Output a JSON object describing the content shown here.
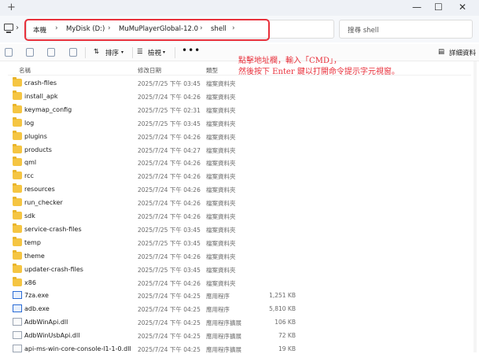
{
  "window": {
    "new_tab": "+",
    "minimize": "—",
    "maximize": "☐",
    "close": "✕"
  },
  "breadcrumb": [
    "本機",
    "MyDisk (D:)",
    "MuMuPlayerGlobal-12.0",
    "shell"
  ],
  "search": {
    "placeholder": "搜尋 shell"
  },
  "toolbar": {
    "sort": "排序",
    "view": "檢視",
    "more": "•••",
    "details": "詳細資料"
  },
  "columns": {
    "name": "名稱",
    "date": "修改日期",
    "type": "類型"
  },
  "annotation": {
    "line1": "點擊地址欄，輸入「CMD」，",
    "line2": "然後按下 Enter 鍵以打開命令提示字元視窗。"
  },
  "files": [
    {
      "name": "crash-files",
      "date": "2025/7/25 下午 03:45",
      "type": "檔案資料夾",
      "size": "",
      "kind": "folder"
    },
    {
      "name": "install_apk",
      "date": "2025/7/24 下午 04:26",
      "type": "檔案資料夾",
      "size": "",
      "kind": "folder"
    },
    {
      "name": "keymap_config",
      "date": "2025/7/25 下午 02:31",
      "type": "檔案資料夾",
      "size": "",
      "kind": "folder"
    },
    {
      "name": "log",
      "date": "2025/7/25 下午 03:45",
      "type": "檔案資料夾",
      "size": "",
      "kind": "folder"
    },
    {
      "name": "plugins",
      "date": "2025/7/24 下午 04:26",
      "type": "檔案資料夾",
      "size": "",
      "kind": "folder"
    },
    {
      "name": "products",
      "date": "2025/7/24 下午 04:27",
      "type": "檔案資料夾",
      "size": "",
      "kind": "folder"
    },
    {
      "name": "qml",
      "date": "2025/7/24 下午 04:26",
      "type": "檔案資料夾",
      "size": "",
      "kind": "folder"
    },
    {
      "name": "rcc",
      "date": "2025/7/24 下午 04:26",
      "type": "檔案資料夾",
      "size": "",
      "kind": "folder"
    },
    {
      "name": "resources",
      "date": "2025/7/24 下午 04:26",
      "type": "檔案資料夾",
      "size": "",
      "kind": "folder"
    },
    {
      "name": "run_checker",
      "date": "2025/7/24 下午 04:26",
      "type": "檔案資料夾",
      "size": "",
      "kind": "folder"
    },
    {
      "name": "sdk",
      "date": "2025/7/24 下午 04:26",
      "type": "檔案資料夾",
      "size": "",
      "kind": "folder"
    },
    {
      "name": "service-crash-files",
      "date": "2025/7/25 下午 03:45",
      "type": "檔案資料夾",
      "size": "",
      "kind": "folder"
    },
    {
      "name": "temp",
      "date": "2025/7/25 下午 03:45",
      "type": "檔案資料夾",
      "size": "",
      "kind": "folder"
    },
    {
      "name": "theme",
      "date": "2025/7/24 下午 04:26",
      "type": "檔案資料夾",
      "size": "",
      "kind": "folder"
    },
    {
      "name": "updater-crash-files",
      "date": "2025/7/25 下午 03:45",
      "type": "檔案資料夾",
      "size": "",
      "kind": "folder"
    },
    {
      "name": "x86",
      "date": "2025/7/24 下午 04:26",
      "type": "檔案資料夾",
      "size": "",
      "kind": "folder"
    },
    {
      "name": "7za.exe",
      "date": "2025/7/24 下午 04:25",
      "type": "應用程序",
      "size": "1,251 KB",
      "kind": "exe"
    },
    {
      "name": "adb.exe",
      "date": "2025/7/24 下午 04:25",
      "type": "應用程序",
      "size": "5,810 KB",
      "kind": "exe"
    },
    {
      "name": "AdbWinApi.dll",
      "date": "2025/7/24 下午 04:25",
      "type": "應用程序擴展",
      "size": "106 KB",
      "kind": "dll"
    },
    {
      "name": "AdbWinUsbApi.dll",
      "date": "2025/7/24 下午 04:25",
      "type": "應用程序擴展",
      "size": "72 KB",
      "kind": "dll"
    },
    {
      "name": "api-ms-win-core-console-l1-1-0.dll",
      "date": "2025/7/24 下午 04:25",
      "type": "應用程序擴展",
      "size": "19 KB",
      "kind": "dll"
    }
  ]
}
